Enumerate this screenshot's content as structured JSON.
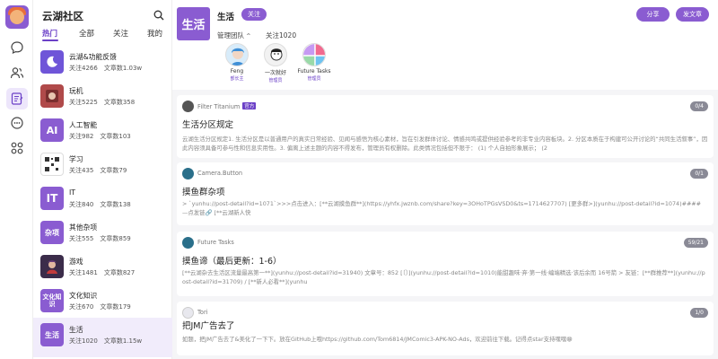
{
  "rail": {
    "icons": [
      "avatar-logo",
      "chat-icon",
      "users-icon",
      "posts-icon",
      "more-icon",
      "apps-icon"
    ]
  },
  "list": {
    "title": "云湖社区",
    "tabs": [
      "热门",
      "全部",
      "关注",
      "我的"
    ],
    "items": [
      {
        "name": "云湖&功能反馈",
        "follows": "关注4266",
        "posts": "文章数1.03w",
        "thumb_text": "",
        "thumb_color": "#6f55d8"
      },
      {
        "name": "玩机",
        "follows": "关注5225",
        "posts": "文章数358",
        "thumb_text": "",
        "thumb_color": "#b04a4a"
      },
      {
        "name": "人工智能",
        "follows": "关注982",
        "posts": "文章数103",
        "thumb_text": "AI",
        "thumb_color": "#8a5cd1"
      },
      {
        "name": "学习",
        "follows": "关注435",
        "posts": "文章数79",
        "thumb_text": "",
        "thumb_color": "#666666"
      },
      {
        "name": "IT",
        "follows": "关注840",
        "posts": "文章数138",
        "thumb_text": "IT",
        "thumb_color": "#8a5cd1"
      },
      {
        "name": "其他杂项",
        "follows": "关注555",
        "posts": "文章数859",
        "thumb_text": "杂项",
        "thumb_color": "#8a5cd1"
      },
      {
        "name": "游戏",
        "follows": "关注1481",
        "posts": "文章数827",
        "thumb_text": "",
        "thumb_color": "#3b2c4a"
      },
      {
        "name": "文化知识",
        "follows": "关注670",
        "posts": "文章数179",
        "thumb_text": "文化知识",
        "thumb_color": "#8a5cd1"
      },
      {
        "name": "生活",
        "follows": "关注1020",
        "posts": "文章数1.15w",
        "thumb_text": "生活",
        "thumb_color": "#8a5cd1"
      }
    ]
  },
  "header": {
    "cover_text": "生活",
    "title": "生活",
    "follow_label": "关注",
    "management": "管理团队",
    "followers": "关注1020",
    "share_label": "分享",
    "post_label": "发文章",
    "admins": [
      {
        "name": "Feng",
        "role": "部长主"
      },
      {
        "name": "一次就好",
        "role": "管理员"
      },
      {
        "name": "Future Tasks",
        "role": "管理员"
      }
    ]
  },
  "posts": [
    {
      "author": "Filter Titanium",
      "badge": "官方",
      "count": "0/4",
      "title": "生活分区规定",
      "body": "云湖生活分区规定1. 生活分区是以普通用户的真实日常经验、见闻与感悟为核心素材，旨在引发群体讨论、情感共鸣或提供经验参考的非专业内容板块。2. 分区本质在于构建可公开讨论的“共同生活叙事”，因此内容须具备可参与性和信息实用性。3. 偏离上述主题的内容不得发布，管理员有权删除。此类情况包括但不限于：      (1) 个人自拍形象展示；      (2"
    },
    {
      "author": "Camera.Button",
      "badge": "",
      "count": "0/1",
      "title": "摸鱼群杂项",
      "body": "> `yunhu://post-detail?id=1071`>>>点击进入：[**云湖摸鱼群**](https://yhfx.jwznb.com/share?key=3OHoTPGsVSD0&ts=1714627707)          [更多群>](yunhu://post-detail?id=1074)#### —点发链🔗 [**云湖新人快"
    },
    {
      "author": "Future Tasks",
      "badge": "",
      "count": "59/21",
      "title": "摸鱼谛（最后更新：1-6）",
      "body": "[**云湖杂去生活区流量最高第一**](yunhu://post-detail?id=31940)    文章号：852 [〔〕](yunhu://post-detail?id=1010)能甜趣味·弃·第一线·编端精选·该后余而    16号箭    > 友链：[**群推荐**](yunhu://post-detail?id=31709) / [**新人必看**](yunhu"
    },
    {
      "author": "Tori",
      "badge": "",
      "count": "1/0",
      "title": "把JM广告去了",
      "body": "如题，把JM广告去了&美化了一下下。放在GitHub上哦https://github.com/Tom6814/JMComic3-APK-NO-Ads，欢迎前往下载。记得点star支持嘿嘿😁"
    }
  ]
}
